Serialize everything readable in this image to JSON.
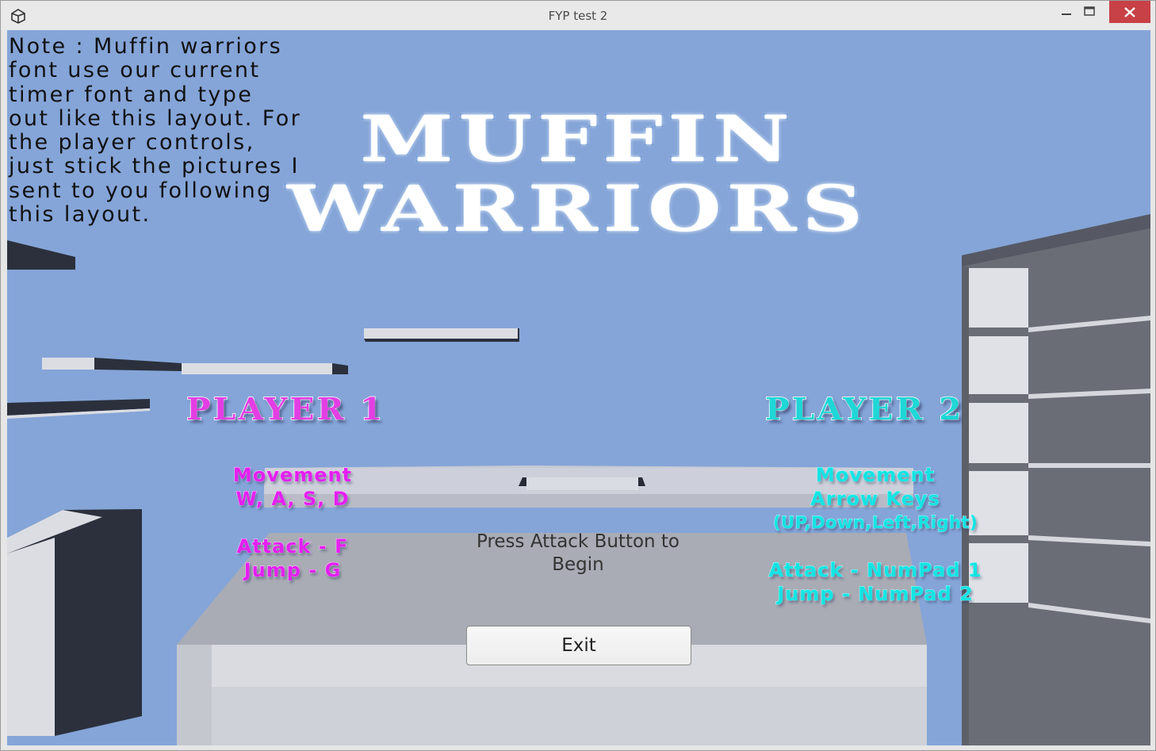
{
  "window": {
    "title": "FYP test 2",
    "controls": [
      "minimize-icon",
      "maximize-icon",
      "close-icon"
    ]
  },
  "note": "Note : Muffin warriors\nfont use our current\ntimer font and type\nout like this layout. For\nthe player controls,\njust stick the pictures I\nsent to you following\nthis layout.",
  "logo": {
    "line1": "MUFFIN",
    "line2": "WARRIORS"
  },
  "player1": {
    "heading": "PLAYER 1",
    "movement_label": "Movement",
    "movement_keys": "W, A, S, D",
    "attack": "Attack - F",
    "jump": "Jump - G",
    "color": "#e33ee4"
  },
  "player2": {
    "heading": "PLAYER 2",
    "movement_label": "Movement",
    "movement_keys": "Arrow Keys",
    "movement_detail": "(UP,Down,Left,Right)",
    "attack": "Attack - NumPad 1",
    "jump": "Jump - NumPad 2",
    "color": "#1ed7d7"
  },
  "prompt": "Press Attack Button to\nBegin",
  "exit_button": "Exit",
  "colors": {
    "sky": "#85a5d8",
    "close_button": "#c74146"
  }
}
